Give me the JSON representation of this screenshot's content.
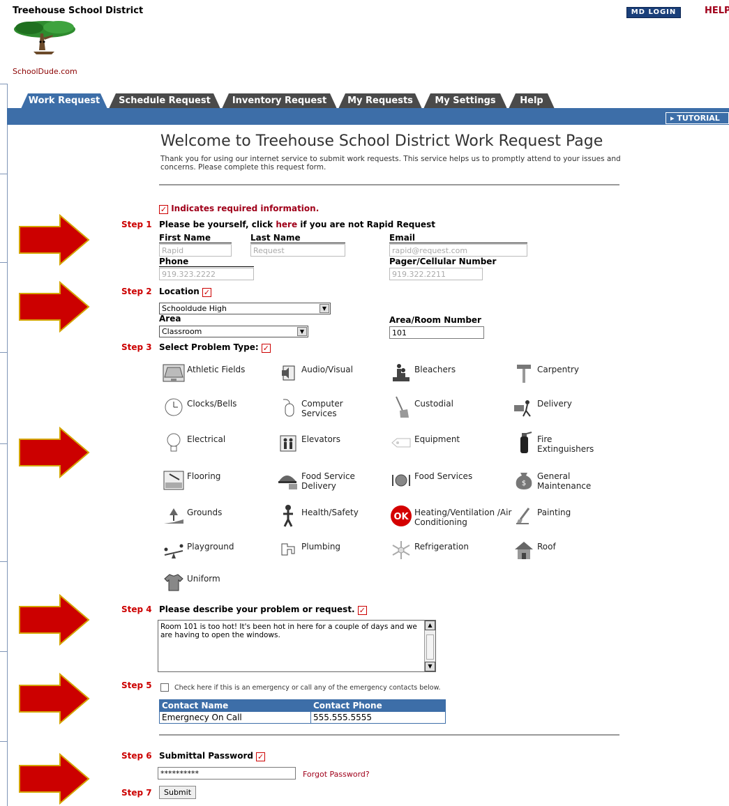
{
  "header": {
    "site_title": "Treehouse School District",
    "brand_link": "SchoolDude.com",
    "login_button": "MD LOGIN",
    "help_link": "HELP"
  },
  "tabs": [
    {
      "label": "Work Request",
      "active": true
    },
    {
      "label": "Schedule Request",
      "active": false
    },
    {
      "label": "Inventory Request",
      "active": false
    },
    {
      "label": "My Requests",
      "active": false
    },
    {
      "label": "My Settings",
      "active": false
    },
    {
      "label": "Help",
      "active": false
    }
  ],
  "tutorial_button": "▸ TUTORIAL",
  "page": {
    "title": "Welcome to Treehouse School District Work Request Page",
    "intro": "Thank you for using our internet service to submit work requests. This service helps us to promptly attend to your issues and concerns. Please complete this request form.",
    "required_note": "Indicates required information."
  },
  "step1": {
    "step": "Step 1",
    "text_before": "Please be yourself, click ",
    "link": "here",
    "text_after": " if you are not Rapid Request",
    "first_name_label": "First Name",
    "first_name_value": "Rapid",
    "last_name_label": "Last Name",
    "last_name_value": "Request",
    "email_label": "Email",
    "email_value": "rapid@request.com",
    "phone_label": "Phone",
    "phone_value": "919.323.2222",
    "pager_label": "Pager/Cellular Number",
    "pager_value": "919.322.2211"
  },
  "step2": {
    "step": "Step 2",
    "label": "Location",
    "location_value": "Schooldude High",
    "area_label": "Area",
    "area_value": "Classroom",
    "room_label": "Area/Room Number",
    "room_value": "101"
  },
  "step3": {
    "step": "Step 3",
    "label": "Select Problem Type:",
    "types": [
      {
        "label": "Athletic Fields",
        "icon": "field-icon"
      },
      {
        "label": "Audio/Visual",
        "icon": "speaker-icon"
      },
      {
        "label": "Bleachers",
        "icon": "bleachers-icon"
      },
      {
        "label": "Carpentry",
        "icon": "hammer-icon"
      },
      {
        "label": "Clocks/Bells",
        "icon": "clock-icon"
      },
      {
        "label": "Computer Services",
        "icon": "mouse-icon"
      },
      {
        "label": "Custodial",
        "icon": "broom-icon"
      },
      {
        "label": "Delivery",
        "icon": "delivery-icon"
      },
      {
        "label": "Electrical",
        "icon": "lightbulb-icon"
      },
      {
        "label": "Elevators",
        "icon": "elevator-icon"
      },
      {
        "label": "Equipment",
        "icon": "tag-icon"
      },
      {
        "label": "Fire Extinguishers",
        "icon": "extinguisher-icon"
      },
      {
        "label": "Flooring",
        "icon": "flooring-icon"
      },
      {
        "label": "Food Service Delivery",
        "icon": "food-delivery-icon"
      },
      {
        "label": "Food Services",
        "icon": "plate-icon"
      },
      {
        "label": "General Maintenance",
        "icon": "moneybag-icon"
      },
      {
        "label": "Grounds",
        "icon": "grounds-icon"
      },
      {
        "label": "Health/Safety",
        "icon": "person-icon"
      },
      {
        "label": "Heating/Ventilation /Air Conditioning",
        "icon": "ok-icon"
      },
      {
        "label": "Painting",
        "icon": "paintbrush-icon"
      },
      {
        "label": "Playground",
        "icon": "seesaw-icon"
      },
      {
        "label": "Plumbing",
        "icon": "faucet-icon"
      },
      {
        "label": "Refrigeration",
        "icon": "snowflake-icon"
      },
      {
        "label": "Roof",
        "icon": "roof-icon"
      },
      {
        "label": "Uniform",
        "icon": "shirt-icon"
      }
    ],
    "selected": "Heating/Ventilation /Air Conditioning",
    "ok_badge": "OK"
  },
  "step4": {
    "step": "Step 4",
    "label": "Please describe your problem or request.",
    "text": "Room 101 is too hot!  It's been hot in here for a couple of days and we are having to open the windows."
  },
  "step5": {
    "step": "Step 5",
    "label": "Check here if this is an emergency or call any of the emergency contacts below.",
    "table_headers": [
      "Contact Name",
      "Contact Phone"
    ],
    "rows": [
      [
        "Emergnecy On Call",
        "555.555.5555"
      ]
    ]
  },
  "step6": {
    "step": "Step 6",
    "label": "Submittal Password",
    "password_value": "**********",
    "forgot_link": "Forgot Password?"
  },
  "step7": {
    "step": "Step 7",
    "submit_label": "Submit"
  },
  "colors": {
    "nav_blue": "#3d6ea8",
    "inactive_tab": "#4a4a4a",
    "step_red": "#cc0000",
    "arrow_red": "#cc0000",
    "arrow_outline": "#d4a400"
  }
}
